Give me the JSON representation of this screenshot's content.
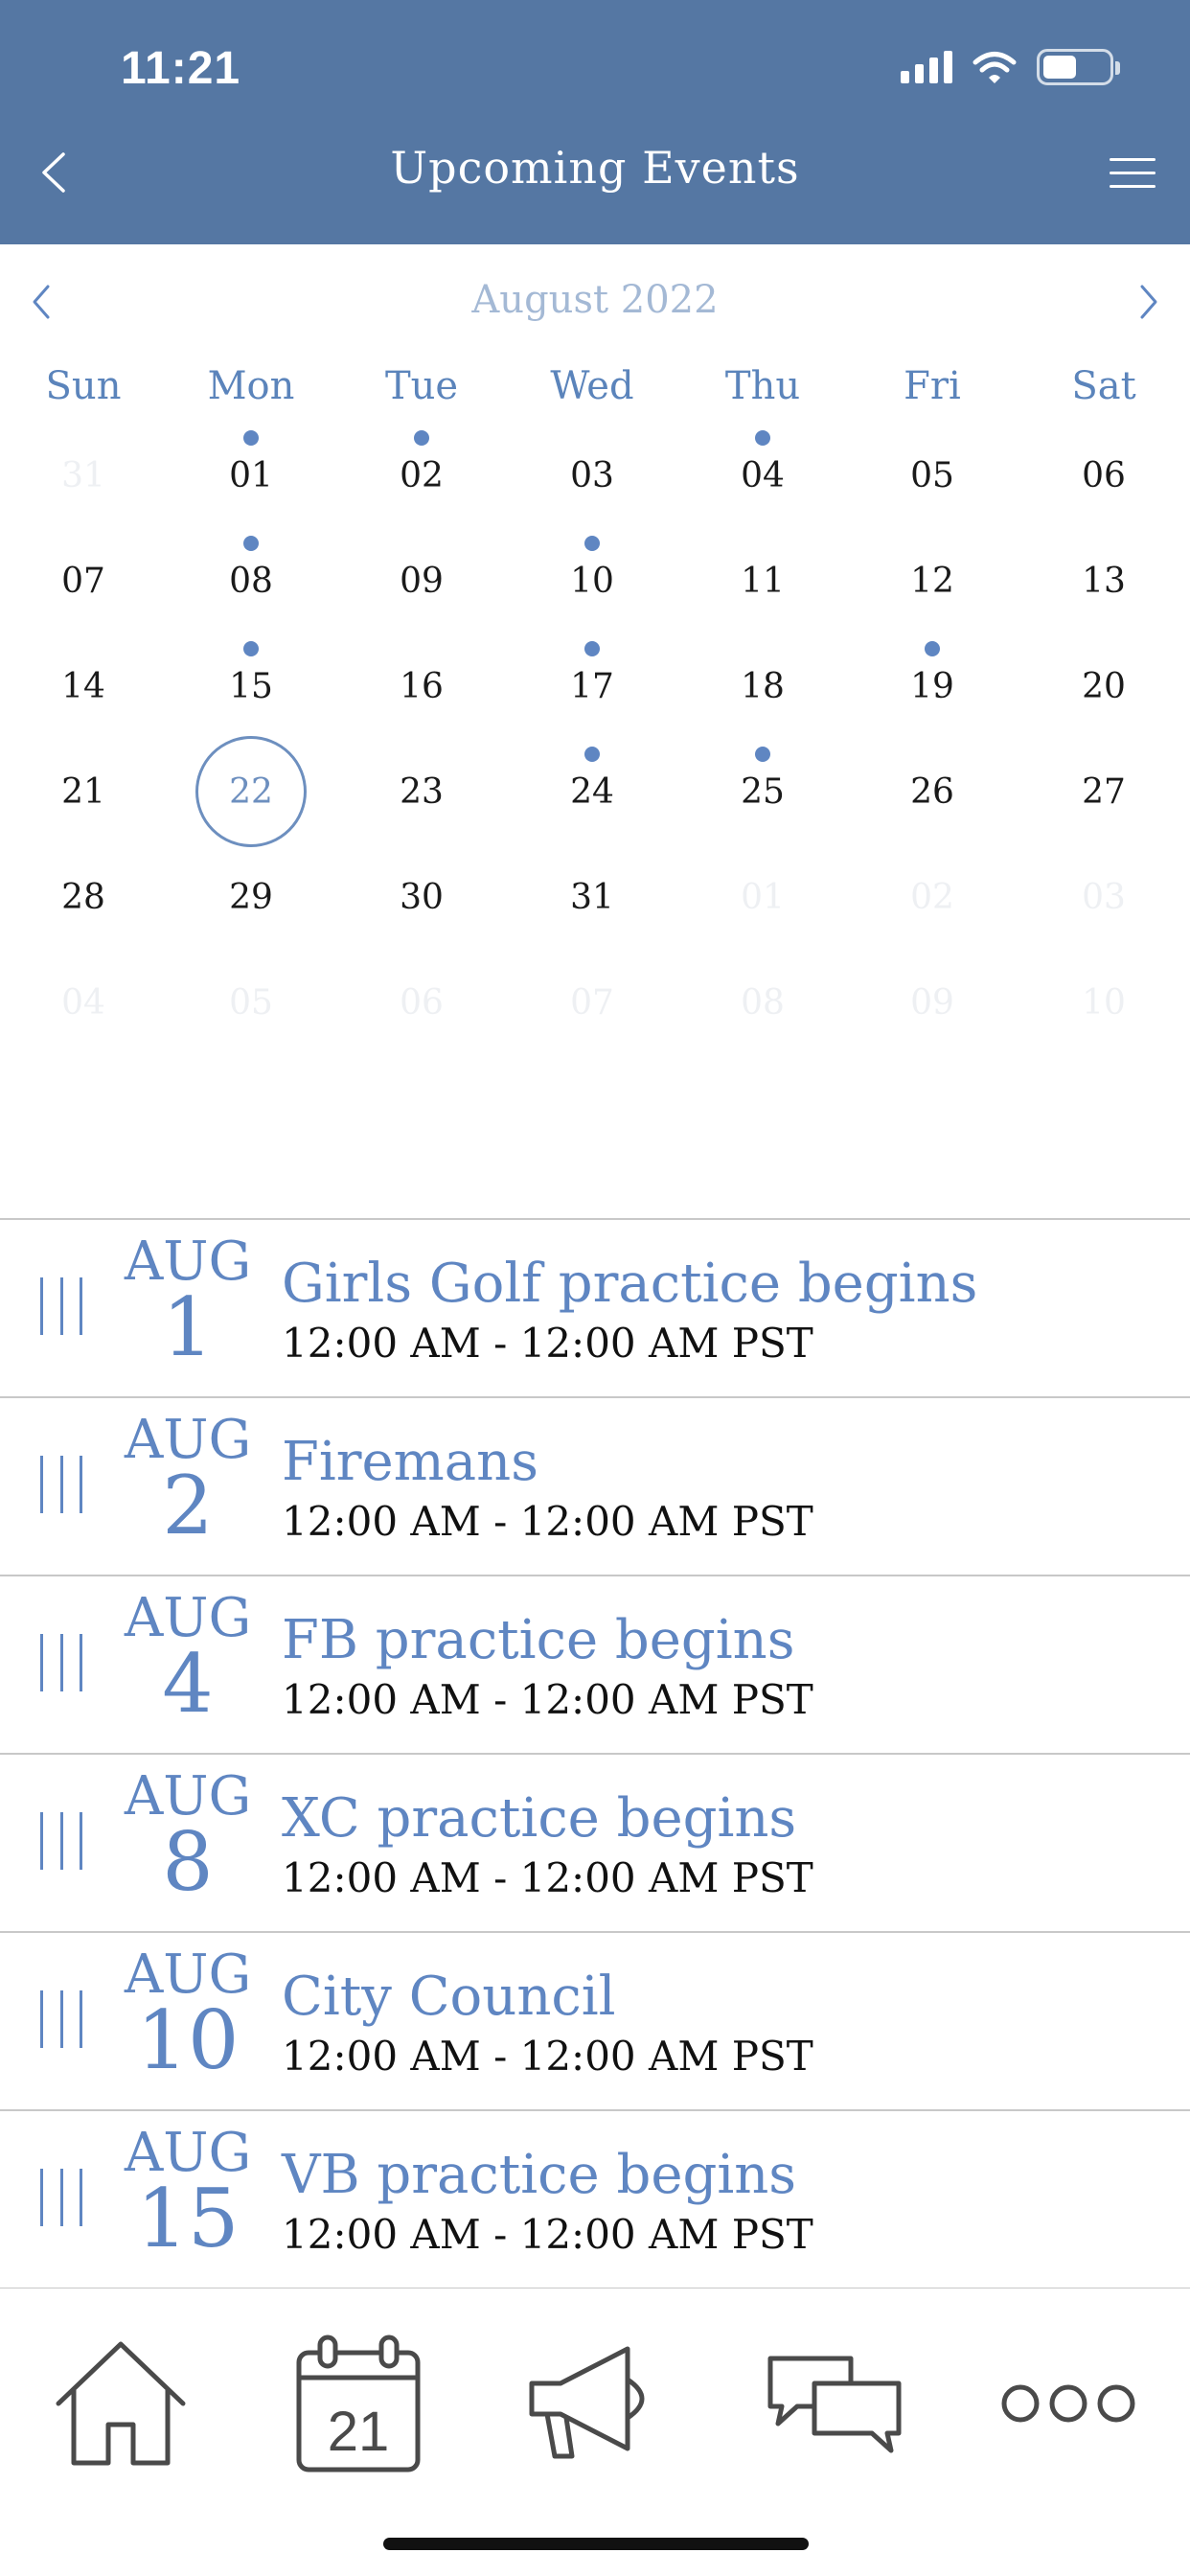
{
  "status_bar": {
    "time": "11:21"
  },
  "header": {
    "title": "Upcoming Events"
  },
  "calendar": {
    "month_label": "August 2022",
    "weekdays": [
      "Sun",
      "Mon",
      "Tue",
      "Wed",
      "Thu",
      "Fri",
      "Sat"
    ],
    "weeks": [
      [
        "31",
        "01",
        "02",
        "03",
        "04",
        "05",
        "06"
      ],
      [
        "07",
        "08",
        "09",
        "10",
        "11",
        "12",
        "13"
      ],
      [
        "14",
        "15",
        "16",
        "17",
        "18",
        "19",
        "20"
      ],
      [
        "21",
        "22",
        "23",
        "24",
        "25",
        "26",
        "27"
      ],
      [
        "28",
        "29",
        "30",
        "31",
        "01",
        "02",
        "03"
      ],
      [
        "04",
        "05",
        "06",
        "07",
        "08",
        "09",
        "10"
      ]
    ],
    "outside_month_days": [
      "31",
      "01",
      "02",
      "03",
      "04",
      "05",
      "06",
      "07",
      "08",
      "09",
      "10"
    ],
    "event_days": [
      "01",
      "02",
      "04",
      "08",
      "10",
      "15",
      "17",
      "19",
      "24",
      "25"
    ],
    "selected_day": "22",
    "accent_color": "#5f86c2"
  },
  "events": [
    {
      "month": "AUG",
      "day": "1",
      "title": "Girls Golf practice begins",
      "time": "12:00 AM - 12:00 AM PST"
    },
    {
      "month": "AUG",
      "day": "2",
      "title": "Firemans",
      "time": "12:00 AM - 12:00 AM PST"
    },
    {
      "month": "AUG",
      "day": "4",
      "title": "FB practice begins",
      "time": "12:00 AM - 12:00 AM PST"
    },
    {
      "month": "AUG",
      "day": "8",
      "title": "XC practice begins",
      "time": "12:00 AM - 12:00 AM PST"
    },
    {
      "month": "AUG",
      "day": "10",
      "title": "City Council",
      "time": "12:00 AM - 12:00 AM PST"
    },
    {
      "month": "AUG",
      "day": "15",
      "title": "VB practice begins",
      "time": "12:00 AM - 12:00 AM PST"
    }
  ],
  "tabbar": {
    "calendar_icon_day": "21",
    "tabs": [
      "home-icon",
      "calendar-icon",
      "megaphone-icon",
      "chat-icon",
      "more-icon"
    ]
  },
  "colors": {
    "header_bg": "#5577a3",
    "accent": "#5f86c2",
    "month_label": "#a4b9d5"
  }
}
